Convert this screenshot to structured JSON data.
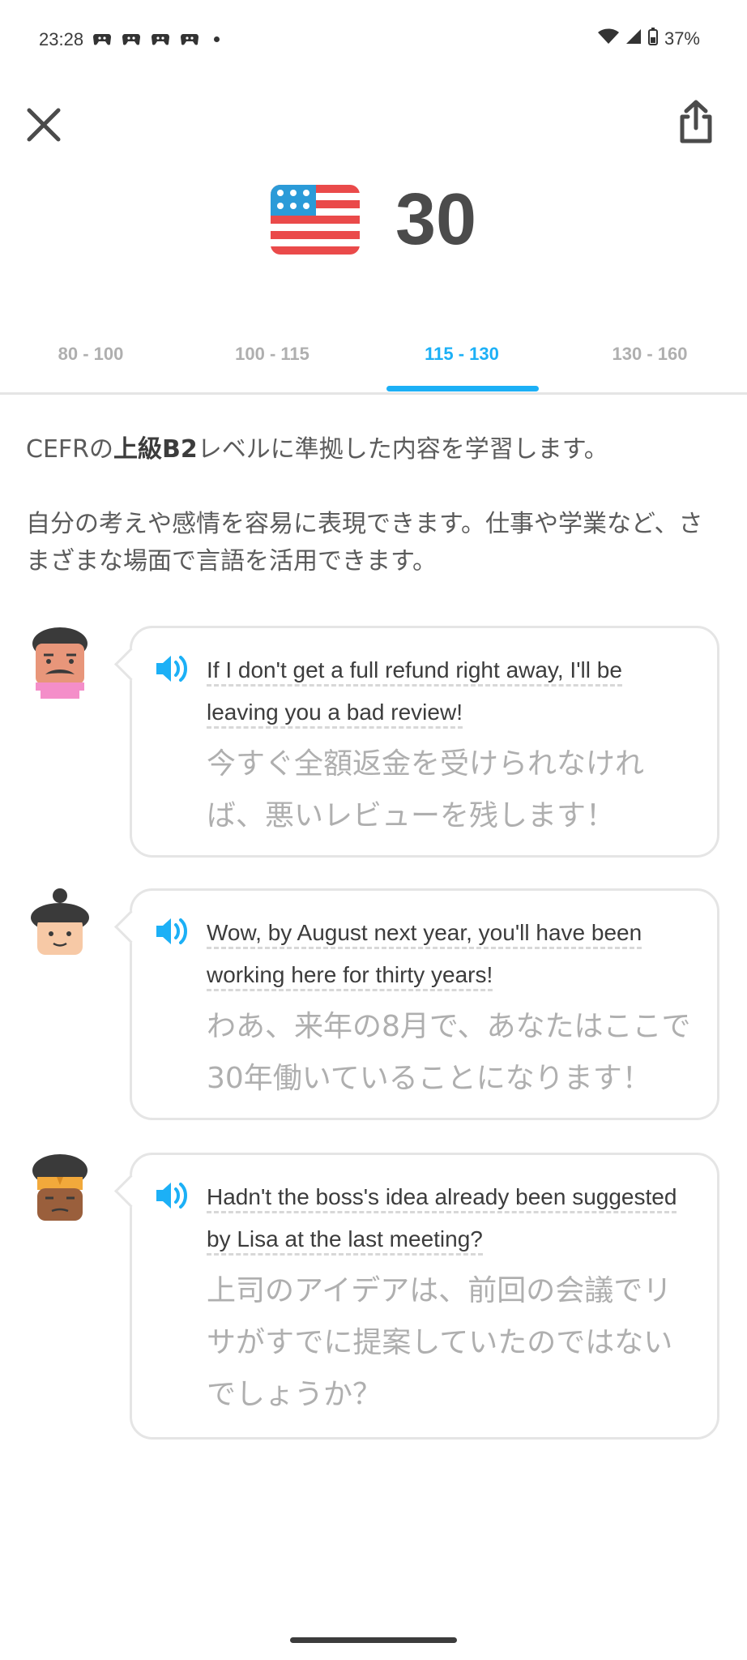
{
  "status_bar": {
    "time": "23:28",
    "battery": "37%"
  },
  "header": {
    "score": "30"
  },
  "tabs": [
    {
      "label": "80 - 100"
    },
    {
      "label": "100 - 115"
    },
    {
      "label": "115 - 130"
    },
    {
      "label": "130 - 160"
    }
  ],
  "description": {
    "line1_prefix": "CEFRの",
    "line1_bold": "上級B2",
    "line1_suffix": "レベルに準拠した内容を学習します。",
    "line2": "自分の考えや感情を容易に表現できます。仕事や学業など、さまざまな場面で言語を活用できます。"
  },
  "dialogues": [
    {
      "english": "If I don't get a full refund right away, I'll be leaving you a bad review!",
      "japanese": "今すぐ全額返金を受けられなければ、悪いレビューを残します！"
    },
    {
      "english": "Wow, by August next year, you'll have been working here for thirty years!",
      "japanese": "わあ、来年の8月で、あなたはここで30年働いていることになります！"
    },
    {
      "english": "Hadn't the boss's idea already been suggested by Lisa at the last meeting?",
      "japanese": "上司のアイデアは、前回の会議でリサがすでに提案していたのではないでしょうか？"
    }
  ],
  "colors": {
    "accent": "#1cb0f6",
    "muted": "#afafaf",
    "text": "#4b4b4b"
  }
}
